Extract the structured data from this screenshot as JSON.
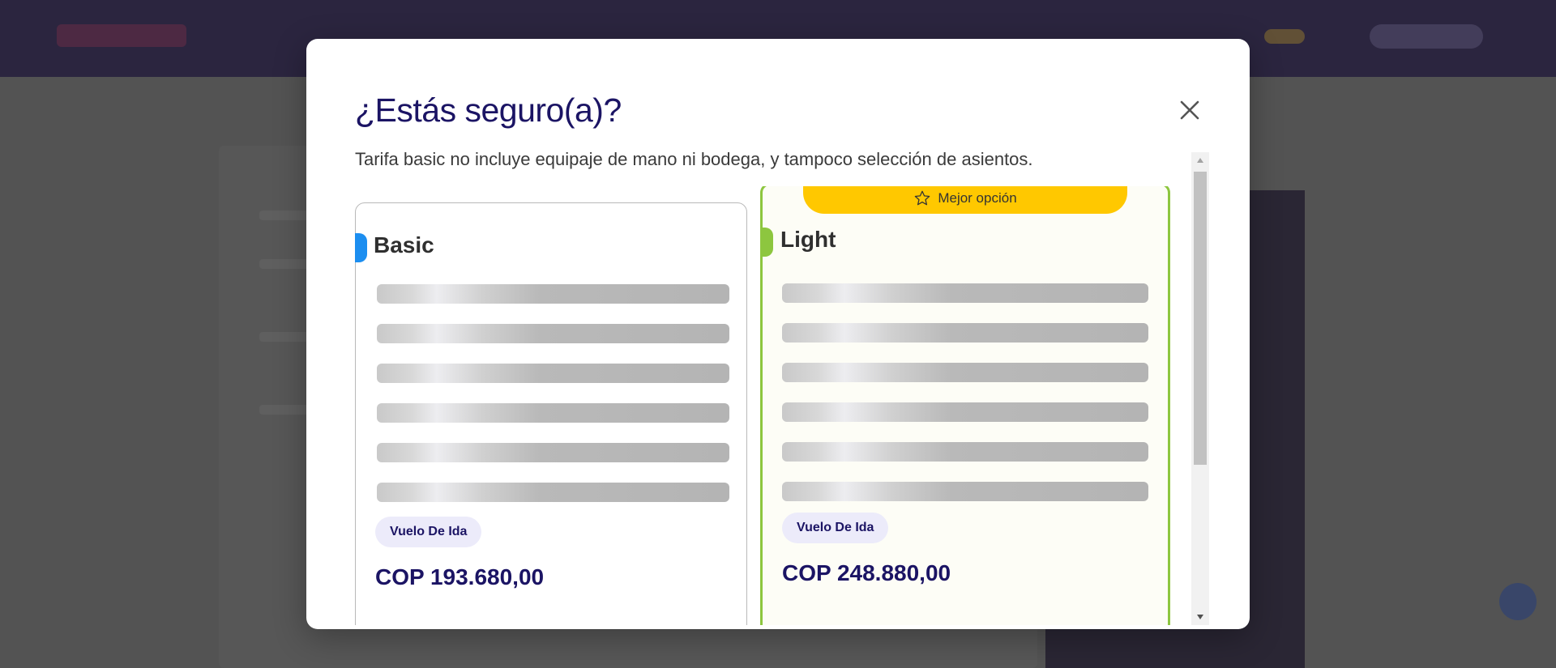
{
  "modal": {
    "title": "¿Estás seguro(a)?",
    "description": "Tarifa basic no incluye equipaje de mano ni bodega, y tampoco selección de asientos.",
    "close_icon": "close-icon"
  },
  "fares": [
    {
      "name": "Basic",
      "accent_color": "#1c8ef0",
      "trip_type": "Vuelo De Ida",
      "price": "COP 193.680,00"
    },
    {
      "name": "Light",
      "accent_color": "#8dc63f",
      "badge": "Mejor opción",
      "badge_icon": "star-icon",
      "trip_type": "Vuelo De Ida",
      "price": "COP 248.880,00"
    }
  ],
  "colors": {
    "brand_navy": "#1b1464",
    "badge_yellow": "#ffc800"
  }
}
